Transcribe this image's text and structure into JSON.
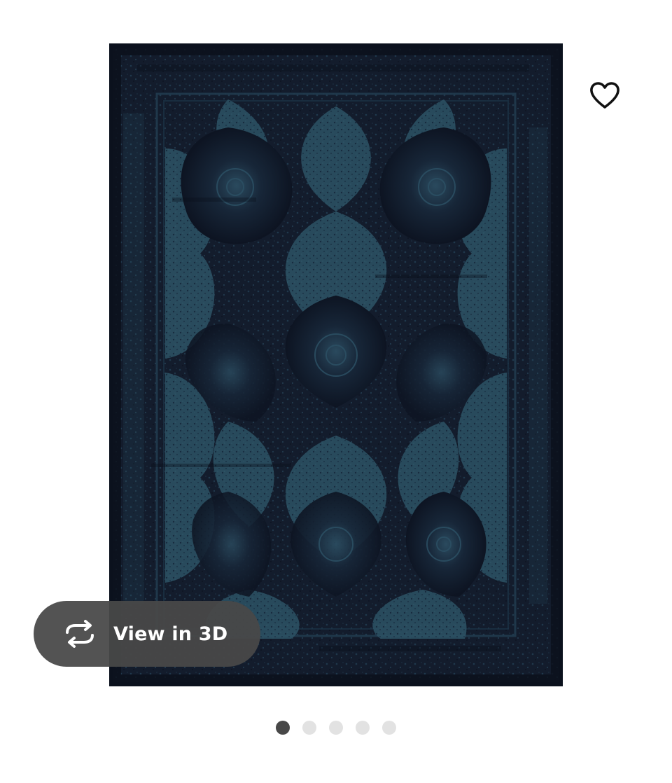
{
  "product_image": {
    "alt": "",
    "rug_colors": {
      "base": "#131c2c",
      "pattern": "#2d5566",
      "dark": "#0b101b"
    }
  },
  "favorite": {
    "icon": "heart-outline-icon",
    "color": "#111111"
  },
  "view_3d": {
    "label": "View in 3D",
    "icon": "rotate-arrows-icon",
    "background": "#484848"
  },
  "carousel": {
    "current_index": 1,
    "total": 5,
    "dots": [
      {
        "active": true
      },
      {
        "active": false
      },
      {
        "active": false
      },
      {
        "active": false
      },
      {
        "active": false
      }
    ]
  }
}
